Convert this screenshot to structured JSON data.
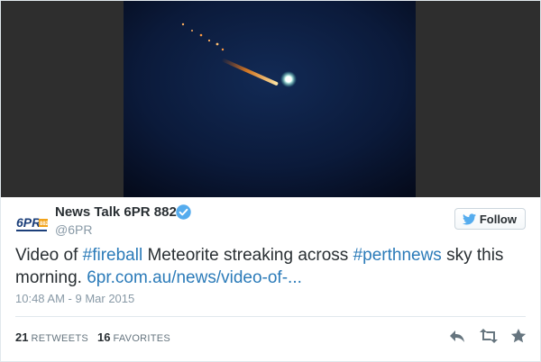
{
  "tweet": {
    "display_name": "News Talk 6PR 882",
    "handle": "@6PR",
    "follow_label": "Follow",
    "text_parts": {
      "p1": "Video of ",
      "hashtag1": "#fireball",
      "p2": " Meteorite streaking across ",
      "hashtag2": "#perthnews",
      "p3": " sky this morning. ",
      "link": "6pr.com.au/news/video-of-..."
    },
    "timestamp": "10:48 AM - 9 Mar 2015",
    "stats": {
      "retweets_count": "21",
      "retweets_label": "RETWEETS",
      "favorites_count": "16",
      "favorites_label": "FAVORITES"
    },
    "avatar": {
      "logo_text": "6PR",
      "sub_text": "882"
    }
  },
  "colors": {
    "link": "#2b7bb9",
    "verified": "#55acee",
    "muted": "#8899a6",
    "sky": "#0b1a3a"
  },
  "icons": [
    "video-still",
    "verified-badge-icon",
    "twitter-bird-icon",
    "reply-icon",
    "retweet-icon",
    "favorite-star-icon"
  ]
}
